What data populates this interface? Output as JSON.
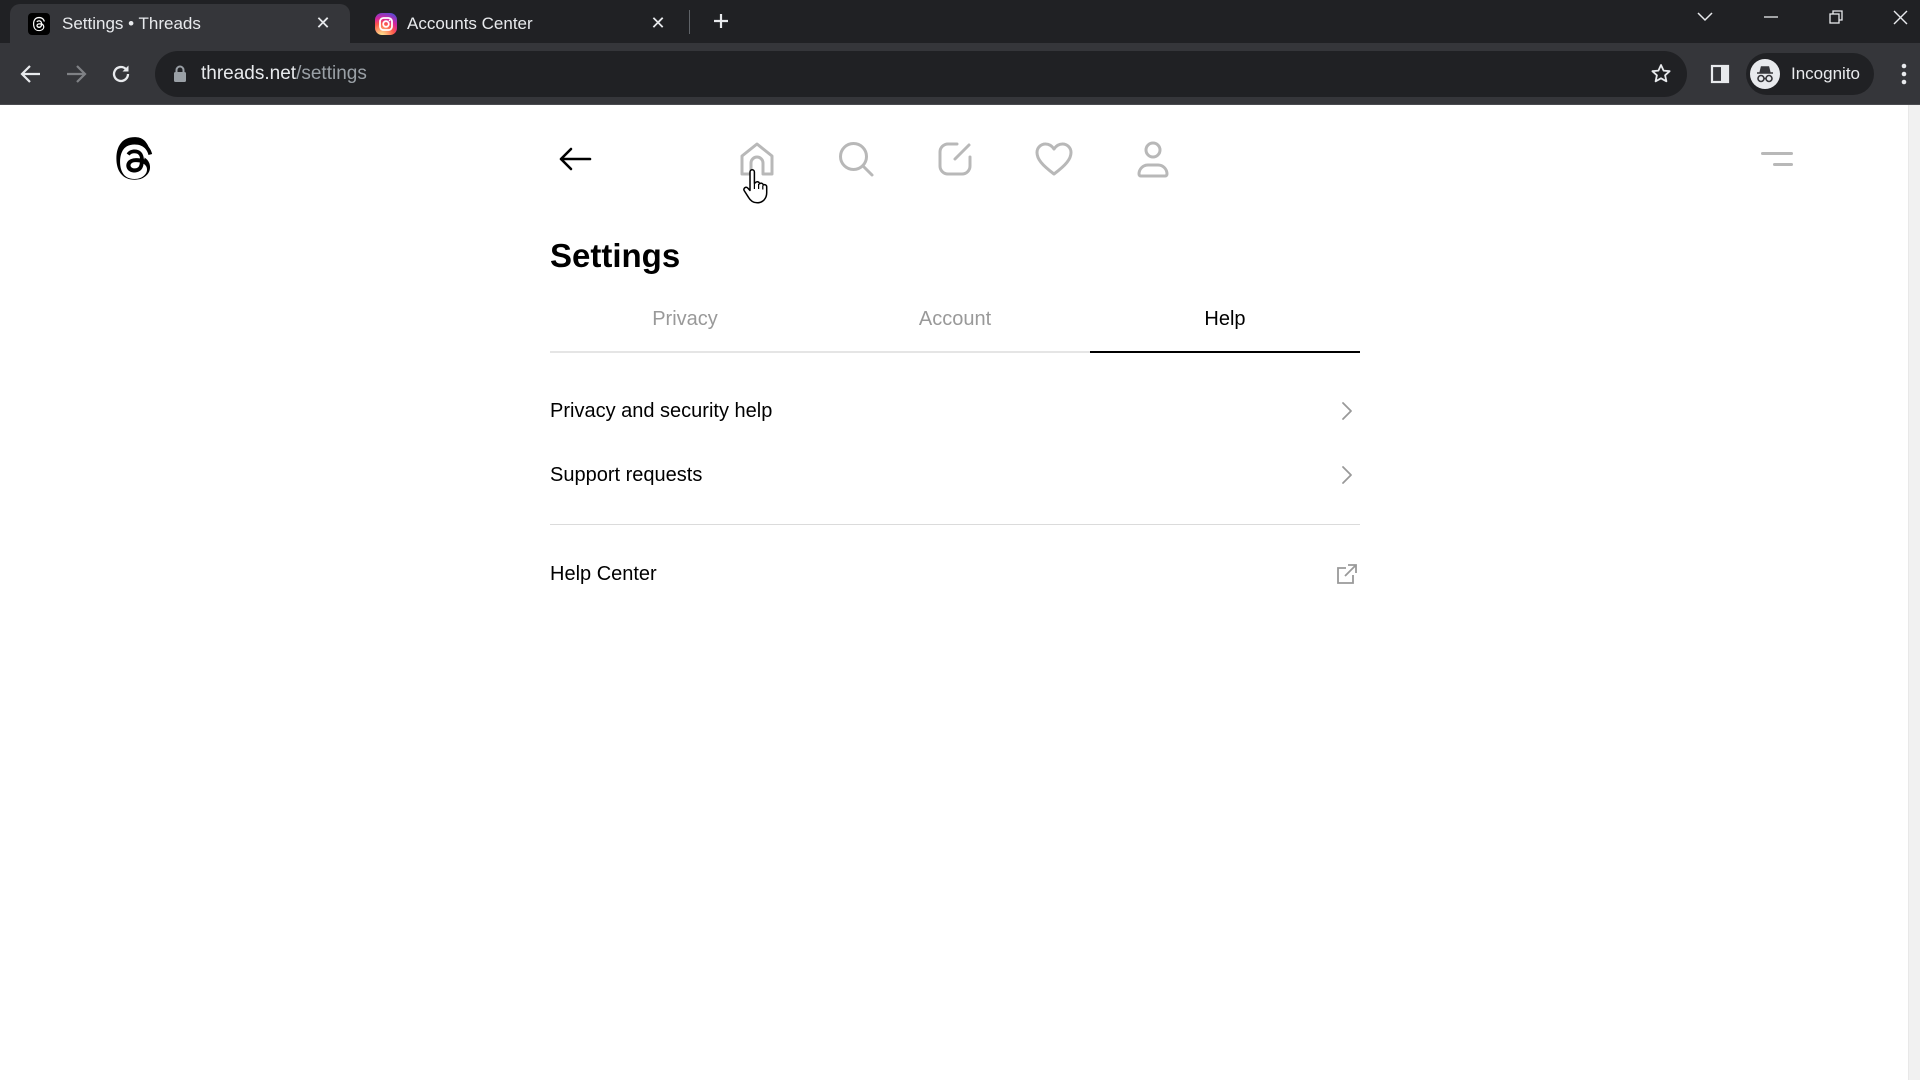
{
  "browser": {
    "tabs": [
      {
        "title": "Settings • Threads",
        "favicon": "threads-logo-icon",
        "active": true
      },
      {
        "title": "Accounts Center",
        "favicon": "instagram-logo-icon",
        "active": false
      }
    ],
    "close_glyph": "✕",
    "new_tab_glyph": "+",
    "url_domain": "threads.net",
    "url_path": "/settings",
    "profile_label": "Incognito"
  },
  "app": {
    "nav_icons": [
      "back-arrow-icon",
      "home-icon",
      "search-icon",
      "compose-icon",
      "heart-icon",
      "profile-icon"
    ],
    "page_title": "Settings",
    "tabs": [
      {
        "label": "Privacy",
        "active": false
      },
      {
        "label": "Account",
        "active": false
      },
      {
        "label": "Help",
        "active": true
      }
    ],
    "help_items": [
      {
        "label": "Privacy and security help",
        "icon": "chevron-right-icon"
      },
      {
        "label": "Support requests",
        "icon": "chevron-right-icon"
      }
    ],
    "help_center": {
      "label": "Help Center",
      "icon": "external-link-icon"
    }
  },
  "colors": {
    "tabstrip_bg": "#202124",
    "toolbar_bg": "#35363a",
    "active_text": "#000000",
    "inactive_tab_text": "#999999",
    "nav_icon_inactive": "#b8b8b8"
  }
}
